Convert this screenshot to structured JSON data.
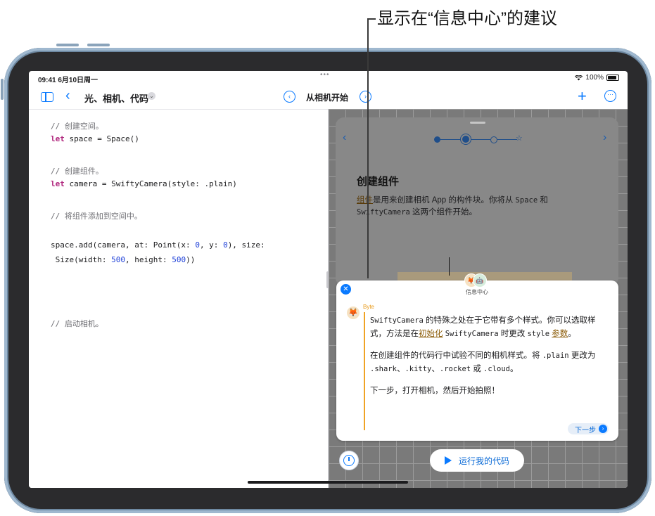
{
  "callout": {
    "label": "显示在“信息中心”的建议"
  },
  "status_bar": {
    "time": "09:41",
    "date": "6月10日周一",
    "center_dots": "•••",
    "battery_percent": "100%",
    "wifi_icon": "wifi-icon",
    "battery_icon": "battery-icon"
  },
  "nav": {
    "book_title": "光、相机、代码",
    "page_title": "从相机开始",
    "sidebar_icon": "sidebar-icon",
    "back_icon": "chevron-left-icon",
    "add_icon": "plus-icon",
    "more_icon": "ellipsis-circle-icon",
    "back_glyph": "‹",
    "title_chevron": "⌄",
    "prev_glyph": "‹",
    "next_glyph": "›",
    "add_glyph": "+",
    "more_glyph": "···"
  },
  "code": {
    "c1": "// 创建空间。",
    "kw1": "let",
    "l1": " space = Space()",
    "c2": "// 创建组件。",
    "kw2": "let",
    "l2": " camera = SwiftyCamera(style: .plain)",
    "c3": "// 将组件添加到空间中。",
    "l3a": "space.add(camera, at: Point(x: ",
    "n1": "0",
    "l3b": ", y: ",
    "n2": "0",
    "l3c": "), size:",
    "l4a": " Size(width: ",
    "n3": "500",
    "l4b": ", height: ",
    "n4": "500",
    "l4c": "))",
    "c4": "// 启动相机。"
  },
  "guide": {
    "prev_glyph": "‹",
    "next_glyph": "›",
    "heading": "创建组件",
    "p1_link": "组件",
    "p1_a": "是用来创建相机 App 的构件块。你将从 ",
    "p1_code1": "Space",
    "p1_b": " 和 ",
    "p1_code2": "SwiftyCamera",
    "p1_c": " 这两个组件开始。"
  },
  "learning_center": {
    "label": "信息中心",
    "close_glyph": "✕",
    "author": "Byte",
    "avatar_glyphs": [
      "🦊",
      "🤖"
    ],
    "para1": {
      "code1": "SwiftyCamera",
      "a": " 的特殊之处在于它带有多个样式。你可以选取样式，方法是在",
      "link1": "初始化",
      "b": " ",
      "code2": "SwiftyCamera",
      "c": " 时更改 ",
      "code3": "style",
      "d": " ",
      "link2": "参数",
      "e": "。"
    },
    "para2": {
      "a": "在创建组件的代码行中试验不同的相机样式。将 ",
      "code1": ".plain",
      "b": " 更改为 ",
      "code2": ".shark",
      "c": "、",
      "code3": ".kitty",
      "d": "、",
      "code4": ".rocket",
      "e": " 或 ",
      "code5": ".cloud",
      "f": "。"
    },
    "para3": "下一步，打开相机，然后开始拍照！",
    "next_label": "下一步",
    "next_glyph": "›"
  },
  "run_button": {
    "label": "运行我的代码"
  },
  "colors": {
    "accent": "#0a7aff",
    "keyword": "#b0267d",
    "number": "#1e40d8",
    "comment": "#6e6e73",
    "author": "#e89a1a"
  }
}
